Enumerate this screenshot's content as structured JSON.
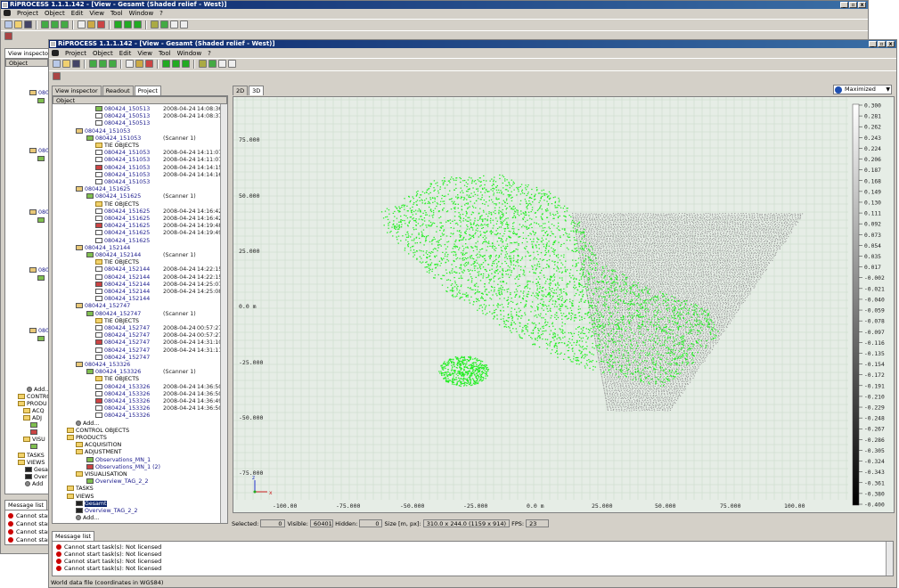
{
  "back_window": {
    "title": "RiPROCESS 1.1.1.142 - [View - Gesamt (Shaded relief - West)]",
    "menu": [
      "Project",
      "Object",
      "Edit",
      "View",
      "Tool",
      "Window",
      "?"
    ],
    "tabs": [
      "View inspector",
      "Re"
    ],
    "obj_header": "Object",
    "tree": [
      "Add...",
      "CONTROL",
      "PRODU",
      "ACQ",
      "ADJ",
      "VISU",
      "TASKS",
      "VIEWS",
      "Gesan",
      "Over",
      "Add"
    ],
    "side_labels": [
      "080",
      "080",
      "080",
      "080",
      "080"
    ],
    "msg_tab": "Message list",
    "msgs": [
      "Cannot star",
      "Cannot star",
      "Cannot star",
      "Cannot star"
    ]
  },
  "front_window": {
    "title": "RiPROCESS 1.1.1.142 - [View - Gesamt (Shaded relief - West)]",
    "menu": [
      "Project",
      "Object",
      "Edit",
      "View",
      "Tool",
      "Window",
      "?"
    ],
    "left_tabs": [
      "View inspector",
      "Readout",
      "Project"
    ],
    "obj_header": "Object",
    "tree_rows": [
      {
        "indent": 2,
        "icon": "scan",
        "name": "080424_150513",
        "date": "2008-04-24",
        "time": "14:08:36"
      },
      {
        "indent": 2,
        "icon": "doc",
        "name": "080424_150513",
        "date": "2008-04-24",
        "time": "14:08:37"
      },
      {
        "indent": 2,
        "icon": "doc",
        "name": "080424_150513",
        "date": "",
        "time": ""
      },
      {
        "indent": 0,
        "icon": "obj",
        "name": "080424_151053",
        "date": "",
        "time": ""
      },
      {
        "indent": 1,
        "icon": "scan",
        "name": "080424_151053",
        "date": "(Scanner 1)",
        "time": ""
      },
      {
        "indent": 2,
        "icon": "fold",
        "name": "TIE OBJECTS",
        "date": "",
        "time": ""
      },
      {
        "indent": 2,
        "icon": "doc",
        "name": "080424_151053",
        "date": "2008-04-24",
        "time": "14:11:07"
      },
      {
        "indent": 2,
        "icon": "doc",
        "name": "080424_151053",
        "date": "2008-04-24",
        "time": "14:11:07"
      },
      {
        "indent": 2,
        "icon": "red",
        "name": "080424_151053",
        "date": "2008-04-24",
        "time": "14:14:15"
      },
      {
        "indent": 2,
        "icon": "doc",
        "name": "080424_151053",
        "date": "2008-04-24",
        "time": "14:14:16"
      },
      {
        "indent": 2,
        "icon": "doc",
        "name": "080424_151053",
        "date": "",
        "time": ""
      },
      {
        "indent": 0,
        "icon": "obj",
        "name": "080424_151625",
        "date": "",
        "time": ""
      },
      {
        "indent": 1,
        "icon": "scan",
        "name": "080424_151625",
        "date": "(Scanner 1)",
        "time": ""
      },
      {
        "indent": 2,
        "icon": "fold",
        "name": "TIE OBJECTS",
        "date": "",
        "time": ""
      },
      {
        "indent": 2,
        "icon": "doc",
        "name": "080424_151625",
        "date": "2008-04-24",
        "time": "14:16:42"
      },
      {
        "indent": 2,
        "icon": "doc",
        "name": "080424_151625",
        "date": "2008-04-24",
        "time": "14:16:42"
      },
      {
        "indent": 2,
        "icon": "red",
        "name": "080424_151625",
        "date": "2008-04-24",
        "time": "14:19:48"
      },
      {
        "indent": 2,
        "icon": "doc",
        "name": "080424_151625",
        "date": "2008-04-24",
        "time": "14:19:49"
      },
      {
        "indent": 2,
        "icon": "doc",
        "name": "080424_151625",
        "date": "",
        "time": ""
      },
      {
        "indent": 0,
        "icon": "obj",
        "name": "080424_152144",
        "date": "",
        "time": ""
      },
      {
        "indent": 1,
        "icon": "scan",
        "name": "080424_152144",
        "date": "(Scanner 1)",
        "time": ""
      },
      {
        "indent": 2,
        "icon": "fold",
        "name": "TIE OBJECTS",
        "date": "",
        "time": ""
      },
      {
        "indent": 2,
        "icon": "doc",
        "name": "080424_152144",
        "date": "2008-04-24",
        "time": "14:22:15"
      },
      {
        "indent": 2,
        "icon": "doc",
        "name": "080424_152144",
        "date": "2008-04-24",
        "time": "14:22:15"
      },
      {
        "indent": 2,
        "icon": "red",
        "name": "080424_152144",
        "date": "2008-04-24",
        "time": "14:25:07"
      },
      {
        "indent": 2,
        "icon": "doc",
        "name": "080424_152144",
        "date": "2008-04-24",
        "time": "14:25:08"
      },
      {
        "indent": 2,
        "icon": "doc",
        "name": "080424_152144",
        "date": "",
        "time": ""
      },
      {
        "indent": 0,
        "icon": "obj",
        "name": "080424_152747",
        "date": "",
        "time": ""
      },
      {
        "indent": 1,
        "icon": "scan",
        "name": "080424_152747",
        "date": "(Scanner 1)",
        "time": ""
      },
      {
        "indent": 2,
        "icon": "fold",
        "name": "TIE OBJECTS",
        "date": "",
        "time": ""
      },
      {
        "indent": 2,
        "icon": "doc",
        "name": "080424_152747",
        "date": "2008-04-24",
        "time": "00:57:27"
      },
      {
        "indent": 2,
        "icon": "doc",
        "name": "080424_152747",
        "date": "2008-04-24",
        "time": "00:57:27"
      },
      {
        "indent": 2,
        "icon": "red",
        "name": "080424_152747",
        "date": "2008-04-24",
        "time": "14:31:10"
      },
      {
        "indent": 2,
        "icon": "doc",
        "name": "080424_152747",
        "date": "2008-04-24",
        "time": "14:31:11"
      },
      {
        "indent": 2,
        "icon": "doc",
        "name": "080424_152747",
        "date": "",
        "time": ""
      },
      {
        "indent": 0,
        "icon": "obj",
        "name": "080424_153326",
        "date": "",
        "time": ""
      },
      {
        "indent": 1,
        "icon": "scan",
        "name": "080424_153326",
        "date": "(Scanner 1)",
        "time": ""
      },
      {
        "indent": 2,
        "icon": "fold",
        "name": "TIE OBJECTS",
        "date": "",
        "time": ""
      },
      {
        "indent": 2,
        "icon": "doc",
        "name": "080424_153326",
        "date": "2008-04-24",
        "time": "14:36:50"
      },
      {
        "indent": 2,
        "icon": "doc",
        "name": "080424_153326",
        "date": "2008-04-24",
        "time": "14:36:50"
      },
      {
        "indent": 2,
        "icon": "red",
        "name": "080424_153326",
        "date": "2008-04-24",
        "time": "14:36:49"
      },
      {
        "indent": 2,
        "icon": "doc",
        "name": "080424_153326",
        "date": "2008-04-24",
        "time": "14:36:50"
      },
      {
        "indent": 2,
        "icon": "doc",
        "name": "080424_153326",
        "date": "",
        "time": ""
      },
      {
        "indent": 0,
        "icon": "dot",
        "name": "Add...",
        "date": "",
        "time": ""
      },
      {
        "indent": -1,
        "icon": "fold",
        "name": "CONTROL OBJECTS",
        "date": "",
        "time": ""
      },
      {
        "indent": -1,
        "icon": "fold",
        "name": "PRODUCTS",
        "date": "",
        "time": ""
      },
      {
        "indent": 0,
        "icon": "fold",
        "name": "ACQUISITION",
        "date": "",
        "time": ""
      },
      {
        "indent": 0,
        "icon": "fold",
        "name": "ADJUSTMENT",
        "date": "",
        "time": ""
      },
      {
        "indent": 1,
        "icon": "scan",
        "name": "Observations_MN_1",
        "date": "",
        "time": ""
      },
      {
        "indent": 1,
        "icon": "red",
        "name": "Observations_MN_1 (2)",
        "date": "",
        "time": ""
      },
      {
        "indent": 0,
        "icon": "fold",
        "name": "VISUALISATION",
        "date": "",
        "time": ""
      },
      {
        "indent": 1,
        "icon": "scan",
        "name": "Overview_TAG_2_2",
        "date": "",
        "time": ""
      },
      {
        "indent": -1,
        "icon": "fold",
        "name": "TASKS",
        "date": "",
        "time": ""
      },
      {
        "indent": -1,
        "icon": "fold",
        "name": "VIEWS",
        "date": "",
        "time": ""
      },
      {
        "indent": 0,
        "icon": "view",
        "name": "Gesamt",
        "date": "",
        "time": "",
        "selected": true
      },
      {
        "indent": 0,
        "icon": "view",
        "name": "Overview_TAG_2_2",
        "date": "",
        "time": ""
      },
      {
        "indent": 0,
        "icon": "dot",
        "name": "Add...",
        "date": "",
        "time": ""
      }
    ],
    "view_tabs": [
      "2D",
      "3D"
    ],
    "view_mode": "Maximized",
    "y_ticks": [
      "75.000",
      "50.000",
      "25.000",
      "0.0 m",
      "-25.000",
      "-50.000",
      "-75.000"
    ],
    "x_ticks": [
      "-100.00",
      "-75.000",
      "-50.000",
      "-25.000",
      "0.0 m",
      "25.000",
      "50.000",
      "75.000",
      "100.00"
    ],
    "scale_ticks": [
      "0.300",
      "0.281",
      "0.262",
      "0.243",
      "0.224",
      "0.206",
      "0.187",
      "0.168",
      "0.149",
      "0.130",
      "0.111",
      "0.092",
      "0.073",
      "0.054",
      "0.035",
      "0.017",
      "-0.002",
      "-0.021",
      "-0.040",
      "-0.059",
      "-0.078",
      "-0.097",
      "-0.116",
      "-0.135",
      "-0.154",
      "-0.172",
      "-0.191",
      "-0.210",
      "-0.229",
      "-0.248",
      "-0.267",
      "-0.286",
      "-0.305",
      "-0.324",
      "-0.343",
      "-0.361",
      "-0.380",
      "-0.400"
    ],
    "axis_labels": {
      "z": "z",
      "x": "x"
    },
    "status": {
      "selected_label": "Selected:",
      "selected": "0",
      "visible_label": "Visible:",
      "visible": "60401",
      "hidden_label": "Hidden:",
      "hidden": "0",
      "size_label": "Size [m, px]:",
      "size": "310.0 x 244.0 (1159 x 914)",
      "fps_label": "FPS:",
      "fps": "23"
    },
    "msg_tab": "Message list",
    "msgs": [
      "Cannot start task(s): Not licensed",
      "Cannot start task(s): Not licensed",
      "Cannot start task(s): Not licensed",
      "Cannot start task(s): Not licensed"
    ],
    "footer": "World data file (coordinates in WGS84)"
  },
  "colors": {
    "points_green": "#22ee22",
    "points_grey": "#8a8a8a",
    "grid": "#c8d8c8",
    "view_bg": "#e6ede6"
  }
}
